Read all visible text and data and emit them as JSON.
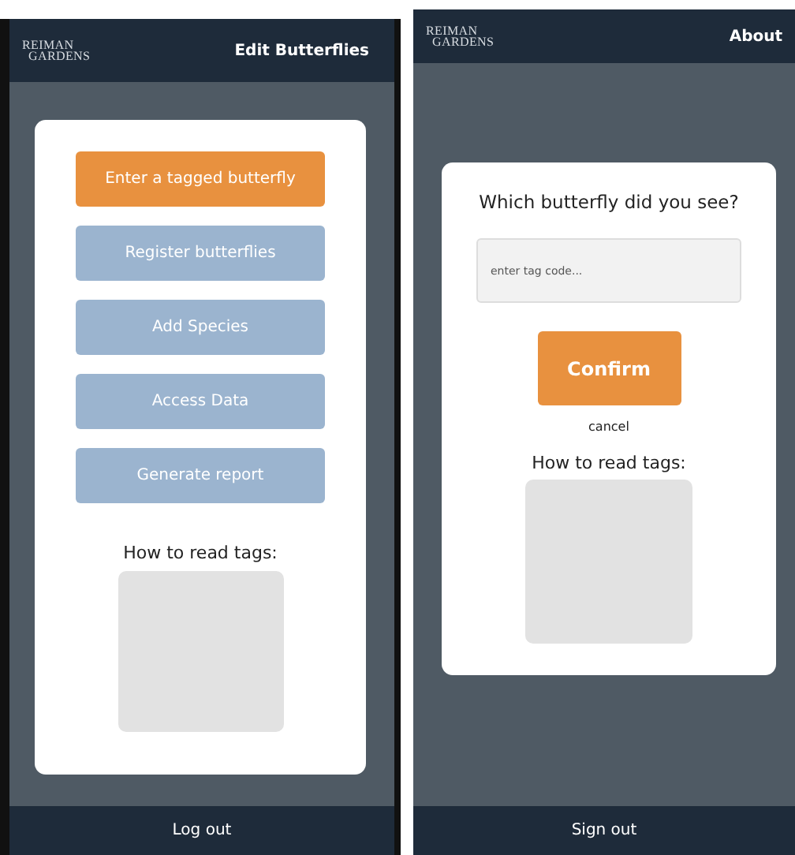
{
  "screens": [
    {
      "kind": "menu",
      "logo": [
        "REIMAN",
        "GARDENS"
      ],
      "header_action": "Edit Butterflies",
      "buttons": [
        {
          "label": "Enter a tagged butterfly",
          "kind": "primary"
        },
        {
          "label": "Register butterflies",
          "kind": "secondary"
        },
        {
          "label": "Add Species",
          "kind": "secondary"
        },
        {
          "label": "Access Data",
          "kind": "secondary"
        },
        {
          "label": "Generate report",
          "kind": "secondary"
        }
      ],
      "help_title": "How to read tags:",
      "footer_action": "Log out"
    },
    {
      "kind": "entry",
      "logo": [
        "REIMAN",
        "GARDENS"
      ],
      "header_action": "About",
      "prompt": "Which butterfly did you see?",
      "tag_field": {
        "placeholder": "enter tag code..."
      },
      "buttons": [
        {
          "label": "Confirm",
          "kind": "primary"
        }
      ],
      "cancel_link": "cancel",
      "help_title": "How to read tags:",
      "footer_action": "Sign out"
    }
  ]
}
